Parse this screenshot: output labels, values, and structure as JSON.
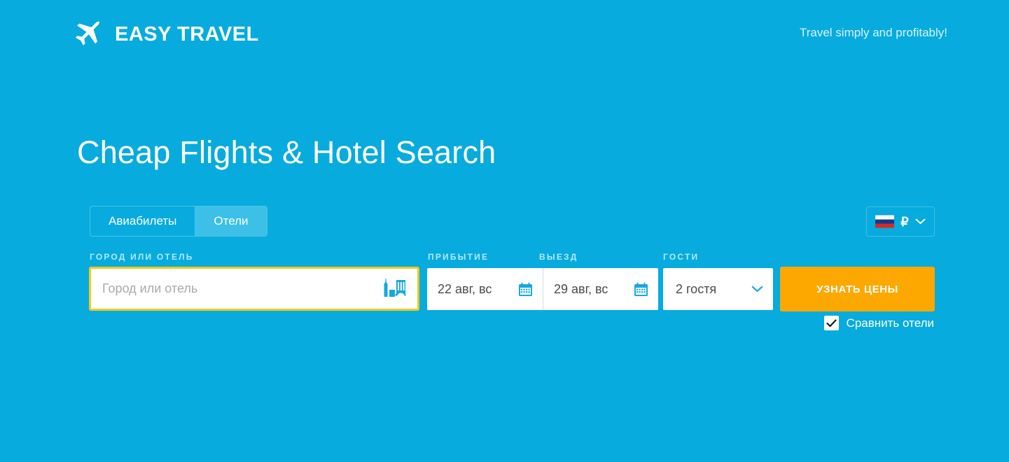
{
  "theme": {
    "background": "#07abdd",
    "accent_orange": "#fda800",
    "highlight_gold": "#f6c917",
    "tab_active": "#3cc0e8",
    "label_blue": "#b6e7f7"
  },
  "header": {
    "logo_icon": "airplane-icon",
    "brand": "EASY TRAVEL",
    "tagline": "Travel simply and profitably!"
  },
  "hero": {
    "title": "Cheap Flights & Hotel Search"
  },
  "tabs": [
    {
      "label": "Авиабилеты",
      "active": false
    },
    {
      "label": "Отели",
      "active": true
    }
  ],
  "currency": {
    "flag": "russia-flag-icon",
    "symbol": "₽",
    "chevron": "chevron-down-icon"
  },
  "search": {
    "city": {
      "label": "ГОРОД ИЛИ ОТЕЛЬ",
      "placeholder": "Город или отель",
      "value": "",
      "icon": "cityscape-icon"
    },
    "checkin": {
      "label": "ПРИБЫТИЕ",
      "value": "22 авг, вс",
      "icon": "calendar-icon"
    },
    "checkout": {
      "label": "ВЫЕЗД",
      "value": "29 авг, вс",
      "icon": "calendar-icon"
    },
    "guests": {
      "label": "ГОСТИ",
      "value": "2 гостя",
      "chevron": "chevron-down-icon"
    },
    "submit_label": "УЗНАТЬ ЦЕНЫ",
    "compare": {
      "label": "Сравнить отели",
      "checked": true
    }
  }
}
